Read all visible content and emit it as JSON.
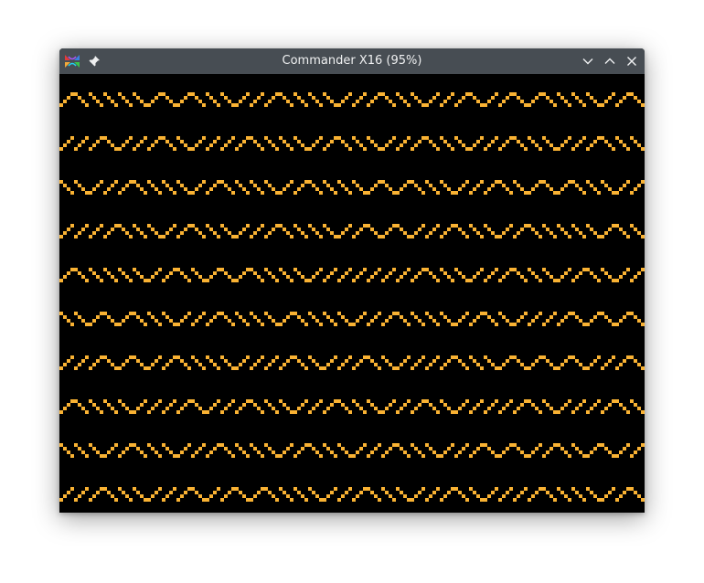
{
  "window": {
    "title": "Commander X16 (95%)",
    "icons": {
      "app": "commander-x16-logo-icon",
      "pin": "pin-icon",
      "minimize": "chevron-down-icon",
      "maximize": "chevron-up-icon",
      "close": "close-icon"
    }
  },
  "screen": {
    "background_color": "#000000",
    "pattern_color": "#f9b233",
    "pattern": "zigzag"
  },
  "colors": {
    "titlebar": "#474d53",
    "title_text": "#eff0f1"
  }
}
